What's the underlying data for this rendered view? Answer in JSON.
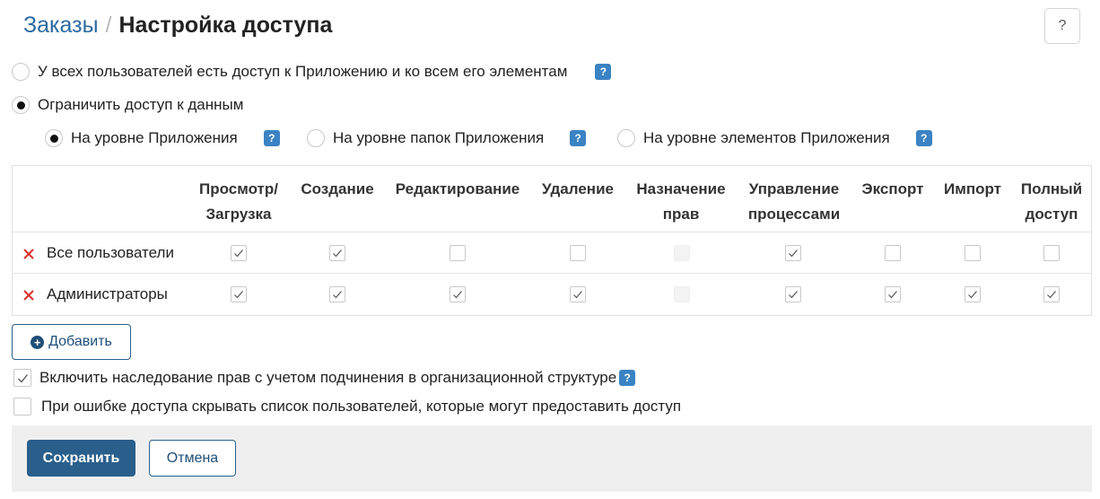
{
  "breadcrumb": {
    "parent": "Заказы",
    "separator": "/",
    "current": "Настройка доступа"
  },
  "help_icon": "?",
  "access_mode": {
    "all_label": "У всех пользователей есть доступ к Приложению и ко всем его элементам",
    "restrict_label": "Ограничить доступ к данным",
    "selected": "restrict"
  },
  "level": {
    "options": [
      "На уровне Приложения",
      "На уровне папок Приложения",
      "На уровне элементов Приложения"
    ],
    "selected": 0
  },
  "badge_text": "?",
  "table": {
    "columns": [
      "Просмотр/\nЗагрузка",
      "Создание",
      "Редактирование",
      "Удаление",
      "Назначение\nправ",
      "Управление\nпроцессами",
      "Экспорт",
      "Импорт",
      "Полный\nдоступ"
    ],
    "rows": [
      {
        "name": "Все пользователи",
        "values": [
          true,
          true,
          false,
          false,
          null,
          true,
          false,
          false,
          false
        ]
      },
      {
        "name": "Администраторы",
        "values": [
          true,
          true,
          true,
          true,
          null,
          true,
          true,
          true,
          true
        ]
      }
    ]
  },
  "add_button": {
    "label": "Добавить"
  },
  "options": {
    "inherit_label": "Включить наследование прав с учетом подчинения в организационной структуре",
    "inherit_checked": true,
    "hide_label": "При ошибке доступа  скрывать список пользователей, которые могут предоставить доступ",
    "hide_checked": false
  },
  "footer": {
    "save_label": "Сохранить",
    "cancel_label": "Отмена"
  },
  "colors": {
    "accent": "#2a5f8c",
    "link": "#2b6aa3",
    "badge": "#3a83c4",
    "remove": "#d9302b"
  },
  "icons": {
    "remove": "close-x-icon",
    "check": "checkmark-icon",
    "add": "plus-circle-icon",
    "help": "question-icon"
  }
}
